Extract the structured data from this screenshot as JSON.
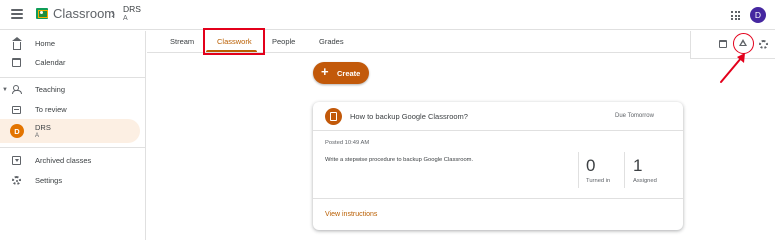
{
  "header": {
    "app_title": "Classroom",
    "class_name": "DRS",
    "class_section": "A",
    "account_initial": "D"
  },
  "sidebar": {
    "items": [
      {
        "label": "Home"
      },
      {
        "label": "Calendar"
      },
      {
        "label": "Teaching"
      },
      {
        "label": "To review"
      },
      {
        "label": "DRS",
        "sub": "A",
        "initial": "D"
      },
      {
        "label": "Archived classes"
      },
      {
        "label": "Settings"
      }
    ]
  },
  "tabs": [
    {
      "label": "Stream"
    },
    {
      "label": "Classwork",
      "active": true
    },
    {
      "label": "People"
    },
    {
      "label": "Grades"
    }
  ],
  "create_button": {
    "label": "Create"
  },
  "assignment": {
    "title": "How to backup Google Classroom?",
    "due": "Due Tomorrow",
    "posted": "Posted 10:49 AM",
    "description": "Write a stepwise procedure to backup Google Classroom.",
    "turned_in_count": "0",
    "turned_in_label": "Turned in",
    "assigned_count": "1",
    "assigned_label": "Assigned",
    "view_link": "View instructions"
  },
  "icons": {
    "menu": "hamburger-icon",
    "apps": "apps-grid-icon",
    "calendar": "calendar-icon",
    "drive": "drive-folder-icon",
    "settings": "gear-icon"
  },
  "colors": {
    "accent": "#b95e00",
    "create_button": "#c2590a",
    "annotation": "#e3001b",
    "avatar": "#4527a0",
    "active_bg": "#fcefe3"
  }
}
